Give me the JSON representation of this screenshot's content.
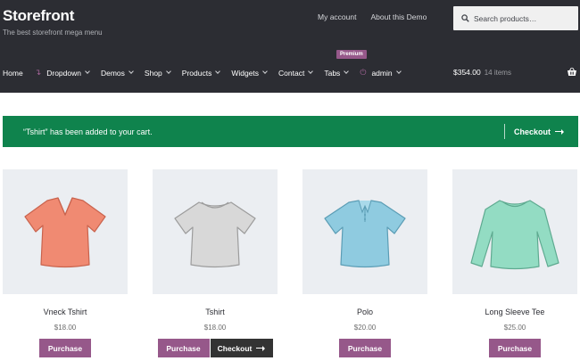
{
  "header": {
    "brand": "Storefront",
    "tagline": "The best storefront mega menu",
    "links": [
      "My account",
      "About this Demo"
    ],
    "search_placeholder": "Search products…"
  },
  "nav": {
    "items": [
      {
        "label": "Home"
      },
      {
        "label": "Dropdown",
        "prefix_icon": "arrow-icon"
      },
      {
        "label": "Demos"
      },
      {
        "label": "Shop"
      },
      {
        "label": "Products"
      },
      {
        "label": "Widgets"
      },
      {
        "label": "Contact"
      },
      {
        "label": "Tabs"
      },
      {
        "label": "admin",
        "prefix_icon": "power-icon"
      }
    ],
    "badge": "Premium",
    "cart_total": "$354.00",
    "cart_count": "14 items"
  },
  "notice": {
    "message": "“Tshirt” has been added to your cart.",
    "button": "Checkout"
  },
  "products": [
    {
      "title": "Vneck Tshirt",
      "price": "$18.00",
      "buttons": [
        "Purchase"
      ],
      "color": "#f08a72"
    },
    {
      "title": "Tshirt",
      "price": "$18.00",
      "buttons": [
        "Purchase",
        "Checkout"
      ],
      "color": "#d8d8d8"
    },
    {
      "title": "Polo",
      "price": "$20.00",
      "buttons": [
        "Purchase"
      ],
      "color": "#8fcbe0"
    },
    {
      "title": "Long Sleeve Tee",
      "price": "$25.00",
      "buttons": [
        "Purchase"
      ],
      "color": "#93dcc3"
    }
  ],
  "colors": {
    "header_bg": "#2c2d33",
    "notice_bg": "#0f834d",
    "accent": "#96588a"
  }
}
